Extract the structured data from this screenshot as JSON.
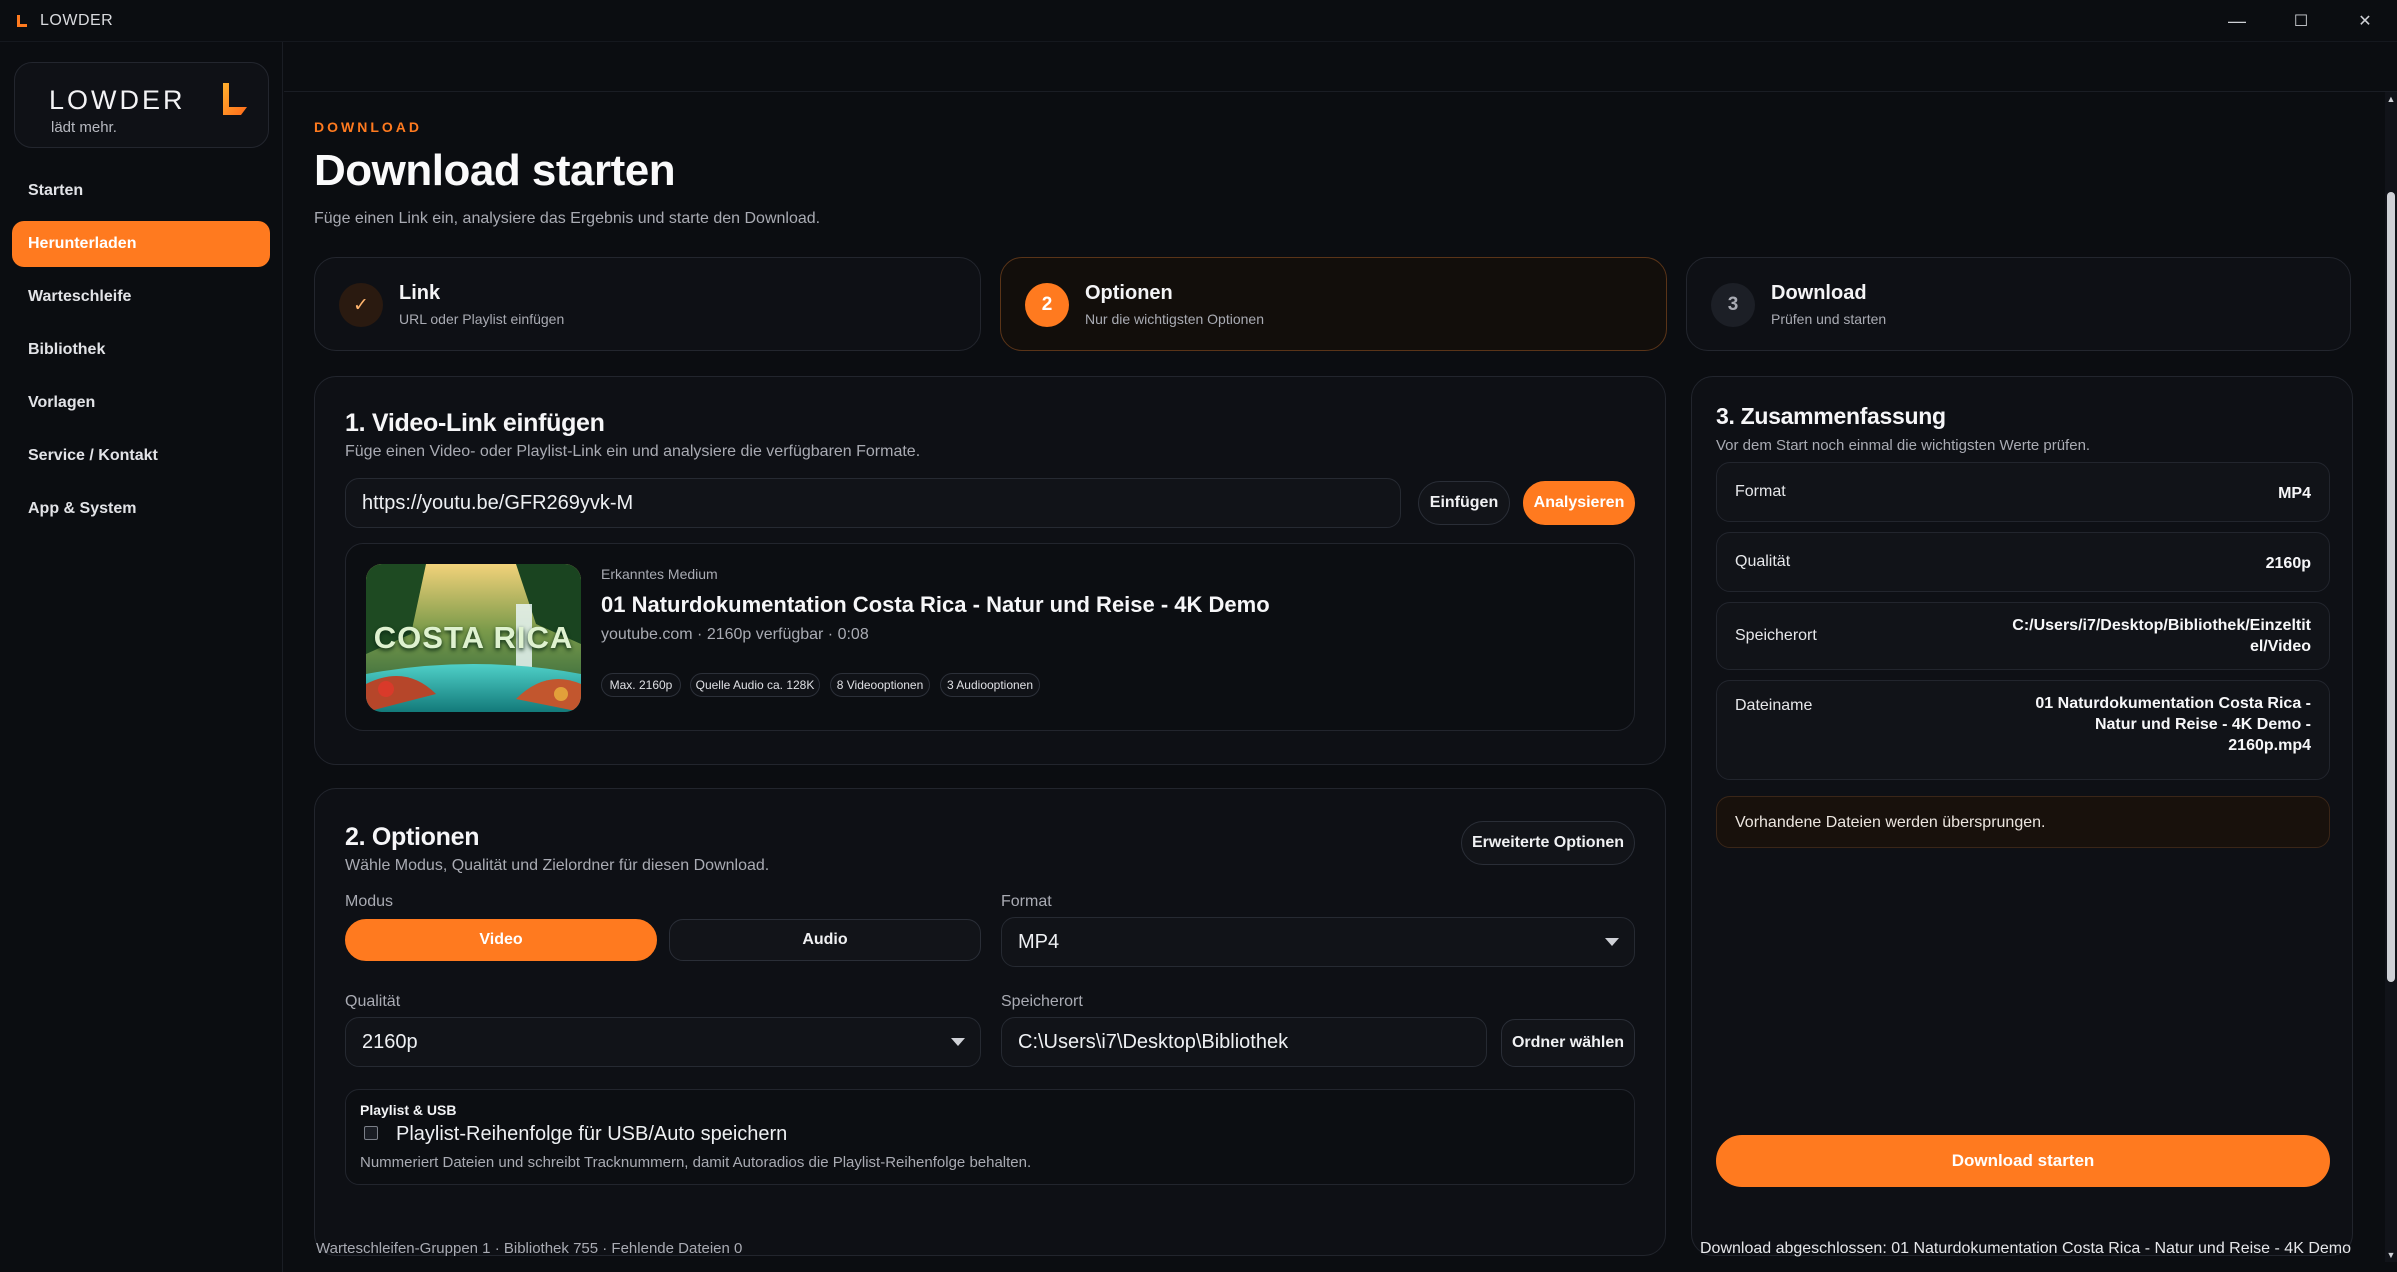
{
  "window": {
    "title": "LOWDER",
    "minimize": "—",
    "maximize": "☐",
    "close": "✕"
  },
  "colors": {
    "accent": "#ff7a1f",
    "background": "#0b0d11",
    "card": "#0e1015"
  },
  "brand": {
    "word": "LOWDER",
    "tagline": "lädt mehr."
  },
  "sidebar": {
    "items": [
      {
        "label": "Starten",
        "active": false
      },
      {
        "label": "Herunterladen",
        "active": true
      },
      {
        "label": "Warteschleife",
        "active": false
      },
      {
        "label": "Bibliothek",
        "active": false
      },
      {
        "label": "Vorlagen",
        "active": false
      },
      {
        "label": "Service / Kontakt",
        "active": false
      },
      {
        "label": "App & System",
        "active": false
      }
    ]
  },
  "header": {
    "eyebrow": "DOWNLOAD",
    "title": "Download starten",
    "subtitle": "Füge einen Link ein, analysiere das Ergebnis und starte den Download."
  },
  "steps": [
    {
      "icon": "✓",
      "title": "Link",
      "sub": "URL oder Playlist einfügen",
      "state": "done"
    },
    {
      "icon": "2",
      "title": "Optionen",
      "sub": "Nur die wichtigsten Optionen",
      "state": "current"
    },
    {
      "icon": "3",
      "title": "Download",
      "sub": "Prüfen und starten",
      "state": "pending"
    }
  ],
  "link_card": {
    "title": "1. Video-Link einfügen",
    "subtitle": "Füge einen Video- oder Playlist-Link ein und analysiere die verfügbaren Formate.",
    "url_value": "https://youtu.be/GFR269yvk-M",
    "paste_label": "Einfügen",
    "analyze_label": "Analysieren",
    "media": {
      "caption": "Erkanntes Medium",
      "title": "01 Naturdokumentation Costa Rica - Natur und Reise - 4K Demo",
      "meta": "youtube.com · 2160p verfügbar · 0:08",
      "thumb_text": "COSTA RICA",
      "chips": [
        "Max. 2160p",
        "Quelle Audio ca. 128K",
        "8 Videooptionen",
        "3 Audiooptionen"
      ]
    }
  },
  "options_card": {
    "title": "2. Optionen",
    "subtitle": "Wähle Modus, Qualität und Zielordner für diesen Download.",
    "advanced_label": "Erweiterte Optionen",
    "mode_label": "Modus",
    "mode_video": "Video",
    "mode_audio": "Audio",
    "format_label": "Format",
    "format_value": "MP4",
    "quality_label": "Qualität",
    "quality_value": "2160p",
    "location_label": "Speicherort",
    "location_value": "C:\\Users\\i7\\Desktop\\Bibliothek",
    "choose_folder_label": "Ordner wählen",
    "playlist_heading": "Playlist & USB",
    "playlist_checkbox_label": "Playlist-Reihenfolge für USB/Auto speichern",
    "playlist_checked": false,
    "playlist_hint": "Nummeriert Dateien und schreibt Tracknummern, damit Autoradios die Playlist-Reihenfolge behalten."
  },
  "summary_card": {
    "title": "3. Zusammenfassung",
    "subtitle": "Vor dem Start noch einmal die wichtigsten Werte prüfen.",
    "rows": [
      {
        "key": "Format",
        "value": "MP4"
      },
      {
        "key": "Qualität",
        "value": "2160p"
      },
      {
        "key": "Speicherort",
        "value_lines": [
          "C:/Users/i7/Desktop/Bibliothek/Einzeltit",
          "el/Video"
        ]
      },
      {
        "key": "Dateiname",
        "value_lines": [
          "01 Naturdokumentation Costa Rica -",
          "Natur und Reise - 4K Demo -",
          "2160p.mp4"
        ]
      }
    ],
    "notice": "Vorhandene Dateien werden übersprungen.",
    "start_label": "Download starten"
  },
  "footer": {
    "left": "Warteschleifen-Gruppen 1 · Bibliothek 755 · Fehlende Dateien 0",
    "right": "Download abgeschlossen: 01 Naturdokumentation Costa Rica - Natur und Reise - 4K Demo"
  }
}
